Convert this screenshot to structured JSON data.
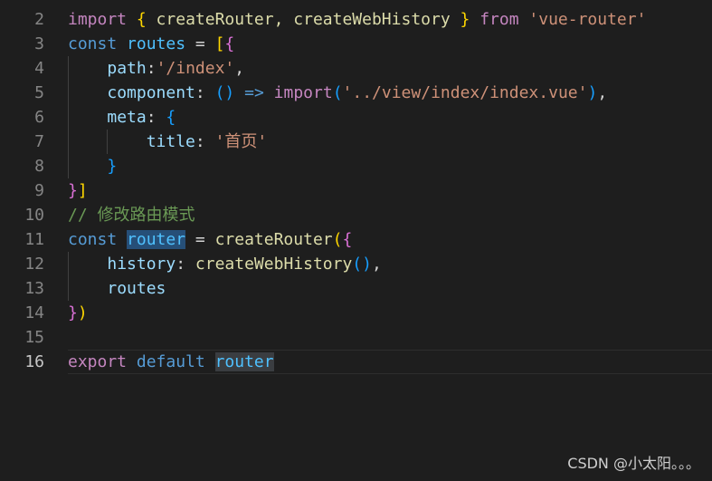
{
  "editor": {
    "lines": [
      {
        "n": "2",
        "tokens": [
          [
            "import",
            "kw"
          ],
          [
            " ",
            "p"
          ],
          [
            "{",
            "b1"
          ],
          [
            " createRouter, createWebHistory ",
            "fn"
          ],
          [
            "}",
            "b1"
          ],
          [
            " ",
            "p"
          ],
          [
            "from",
            "kw"
          ],
          [
            " ",
            "p"
          ],
          [
            "'vue-router'",
            "str"
          ]
        ]
      },
      {
        "n": "3",
        "tokens": [
          [
            "const",
            "st"
          ],
          [
            " ",
            "p"
          ],
          [
            "routes",
            "var"
          ],
          [
            " = ",
            "p"
          ],
          [
            "[",
            "b1"
          ],
          [
            "{",
            "b2"
          ]
        ]
      },
      {
        "n": "4",
        "tokens": [
          [
            "    ",
            "p"
          ],
          [
            "path",
            "prop"
          ],
          [
            ":",
            "p"
          ],
          [
            "'/index'",
            "str"
          ],
          [
            ",",
            "p"
          ]
        ]
      },
      {
        "n": "5",
        "tokens": [
          [
            "    ",
            "p"
          ],
          [
            "component",
            "prop"
          ],
          [
            ": ",
            "p"
          ],
          [
            "()",
            "b3"
          ],
          [
            " ",
            "p"
          ],
          [
            "=>",
            "st"
          ],
          [
            " ",
            "p"
          ],
          [
            "import",
            "kw"
          ],
          [
            "(",
            "b3"
          ],
          [
            "'../view/index/index.vue'",
            "str"
          ],
          [
            ")",
            "b3"
          ],
          [
            ",",
            "p"
          ]
        ]
      },
      {
        "n": "6",
        "tokens": [
          [
            "    ",
            "p"
          ],
          [
            "meta",
            "prop"
          ],
          [
            ": ",
            "p"
          ],
          [
            "{",
            "b3"
          ]
        ]
      },
      {
        "n": "7",
        "tokens": [
          [
            "        ",
            "p"
          ],
          [
            "title",
            "prop"
          ],
          [
            ": ",
            "p"
          ],
          [
            "'首页'",
            "str"
          ]
        ]
      },
      {
        "n": "8",
        "tokens": [
          [
            "    ",
            "p"
          ],
          [
            "}",
            "b3"
          ]
        ]
      },
      {
        "n": "9",
        "tokens": [
          [
            "}",
            "b2"
          ],
          [
            "]",
            "b1"
          ]
        ]
      },
      {
        "n": "10",
        "tokens": [
          [
            "// 修改路由模式",
            "cmt"
          ]
        ]
      },
      {
        "n": "11",
        "tokens": [
          [
            "const",
            "st"
          ],
          [
            " ",
            "p"
          ],
          [
            "router",
            "var-sel"
          ],
          [
            " = ",
            "p"
          ],
          [
            "createRouter",
            "fn"
          ],
          [
            "(",
            "b1"
          ],
          [
            "{",
            "b2"
          ]
        ]
      },
      {
        "n": "12",
        "tokens": [
          [
            "    ",
            "p"
          ],
          [
            "history",
            "prop"
          ],
          [
            ": ",
            "p"
          ],
          [
            "createWebHistory",
            "fn"
          ],
          [
            "()",
            "b3"
          ],
          [
            ",",
            "p"
          ]
        ]
      },
      {
        "n": "13",
        "tokens": [
          [
            "    ",
            "p"
          ],
          [
            "routes",
            "prop"
          ]
        ]
      },
      {
        "n": "14",
        "tokens": [
          [
            "}",
            "b2"
          ],
          [
            ")",
            "b1"
          ]
        ]
      },
      {
        "n": "15",
        "tokens": []
      },
      {
        "n": "16",
        "tokens": [
          [
            "export",
            "kw"
          ],
          [
            " ",
            "p"
          ],
          [
            "default",
            "st"
          ],
          [
            " ",
            "p"
          ],
          [
            "router",
            "var-occ"
          ]
        ],
        "current": true
      }
    ]
  },
  "colors": {
    "background": "#1e1e1e",
    "keyword_control": "#c586c0",
    "keyword_storage": "#569cd6",
    "function": "#dcdcaa",
    "string": "#ce9178",
    "comment": "#6a9955"
  },
  "watermark": "CSDN @小太阳。。。"
}
